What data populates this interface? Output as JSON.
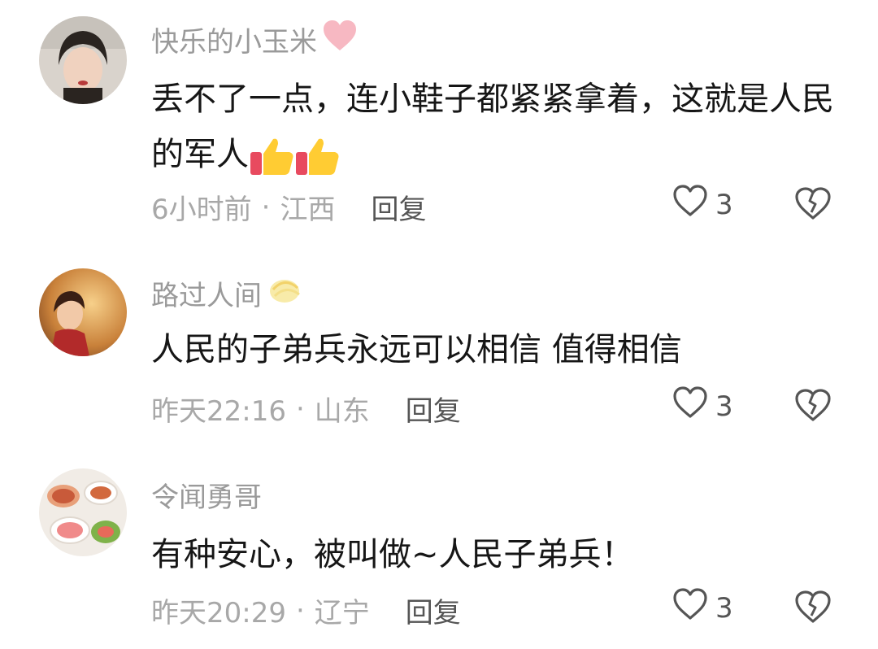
{
  "comments": [
    {
      "username": "快乐的小玉米",
      "username_badge": "pink-heart-icon",
      "text": "丢不了一点，连小鞋子都紧紧拿着，这就是人民的军人",
      "emoji": "thumbs-up-icon",
      "time": "6小时前",
      "location": "江西",
      "reply_label": "回复",
      "like_count": "3"
    },
    {
      "username": "路过人间",
      "username_badge": "sun-sticker-icon",
      "text": "人民的子弟兵永远可以相信 值得相信",
      "time": "昨天22:16",
      "location": "山东",
      "reply_label": "回复",
      "like_count": "3"
    },
    {
      "username": "令闻勇哥",
      "text": "有种安心，被叫做~人民子弟兵！",
      "time": "昨天20:29",
      "location": "辽宁",
      "reply_label": "回复",
      "like_count": "3"
    }
  ],
  "separator": "·",
  "colors": {
    "username": "#9a9a9a",
    "content": "#161616",
    "meta": "#a8a8a8",
    "action": "#555555"
  }
}
